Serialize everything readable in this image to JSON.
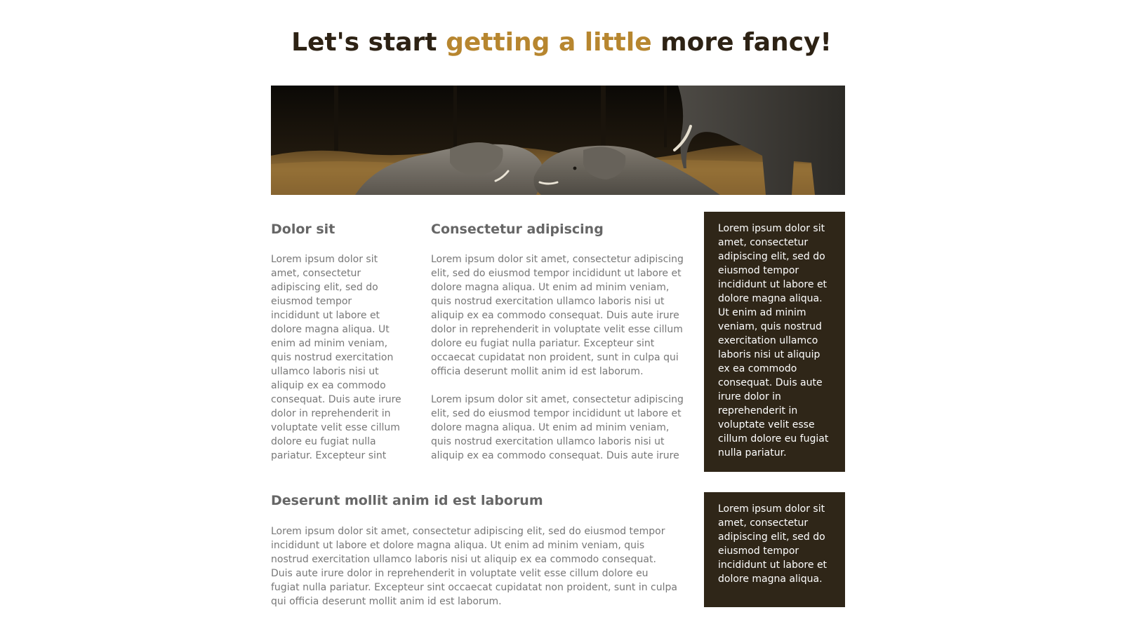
{
  "header": {
    "title_part1": "Let's start ",
    "title_accent": "getting a little",
    "title_part2": " more fancy!"
  },
  "hero": {
    "image_description": "elephants-in-grassland"
  },
  "columns": {
    "left": {
      "heading": "Dolor sit",
      "text": "Lorem ipsum dolor sit amet, consectetur adipiscing elit, sed do eiusmod tempor incididunt ut labore et dolore magna aliqua. Ut enim ad minim veniam, quis nostrud exercitation ullamco laboris nisi ut aliquip ex ea commodo consequat. Duis aute irure dolor in reprehenderit in voluptate velit esse cillum dolore eu fugiat nulla pariatur. Excepteur sint occaecat"
    },
    "middle": {
      "heading": "Consectetur adipiscing",
      "paragraph1": "Lorem ipsum dolor sit amet, consectetur adipiscing elit, sed do eiusmod tempor incididunt ut labore et dolore magna aliqua. Ut enim ad minim veniam, quis nostrud exercitation ullamco laboris nisi ut aliquip ex ea commodo consequat. Duis aute irure dolor in reprehenderit in voluptate velit esse cillum dolore eu fugiat nulla pariatur. Excepteur sint occaecat cupidatat non proident, sunt in culpa qui officia deserunt mollit anim id est laborum.",
      "paragraph2": "Lorem ipsum dolor sit amet, consectetur adipiscing elit, sed do eiusmod tempor incididunt ut labore et dolore magna aliqua. Ut enim ad minim veniam, quis nostrud exercitation ullamco laboris nisi ut aliquip ex ea commodo consequat. Duis aute irure dolor in"
    },
    "sidebar_box_1": {
      "text": "Lorem ipsum dolor sit amet, consectetur adipiscing elit, sed do eiusmod tempor incididunt ut labore et dolore magna aliqua. Ut enim ad minim veniam, quis nostrud exercitation ullamco laboris nisi ut aliquip ex ea commodo consequat. Duis aute irure dolor in reprehenderit in voluptate velit esse cillum dolore eu fugiat nulla pariatur. Excepteur sint occaecat cupidatat"
    }
  },
  "bottom": {
    "heading": "Deserunt mollit anim id est laborum",
    "text": "Lorem ipsum dolor sit amet, consectetur adipiscing elit, sed do eiusmod tempor incididunt ut labore et dolore magna aliqua. Ut enim ad minim veniam, quis nostrud exercitation ullamco laboris nisi ut aliquip ex ea commodo consequat. Duis aute irure dolor in reprehenderit in voluptate velit esse cillum dolore eu fugiat nulla pariatur. Excepteur sint occaecat cupidatat non proident, sunt in culpa qui officia deserunt mollit anim id est laborum.",
    "sidebar_box_2": {
      "text": "Lorem ipsum dolor sit amet, consectetur adipiscing elit, sed do eiusmod tempor incididunt ut labore et dolore magna aliqua. Ut"
    }
  },
  "colors": {
    "title_dark": "#2d2214",
    "title_accent": "#b7862f",
    "heading_gray": "#666666",
    "body_gray": "#777777",
    "box_background": "#2f2618",
    "box_text": "#ffffff"
  }
}
